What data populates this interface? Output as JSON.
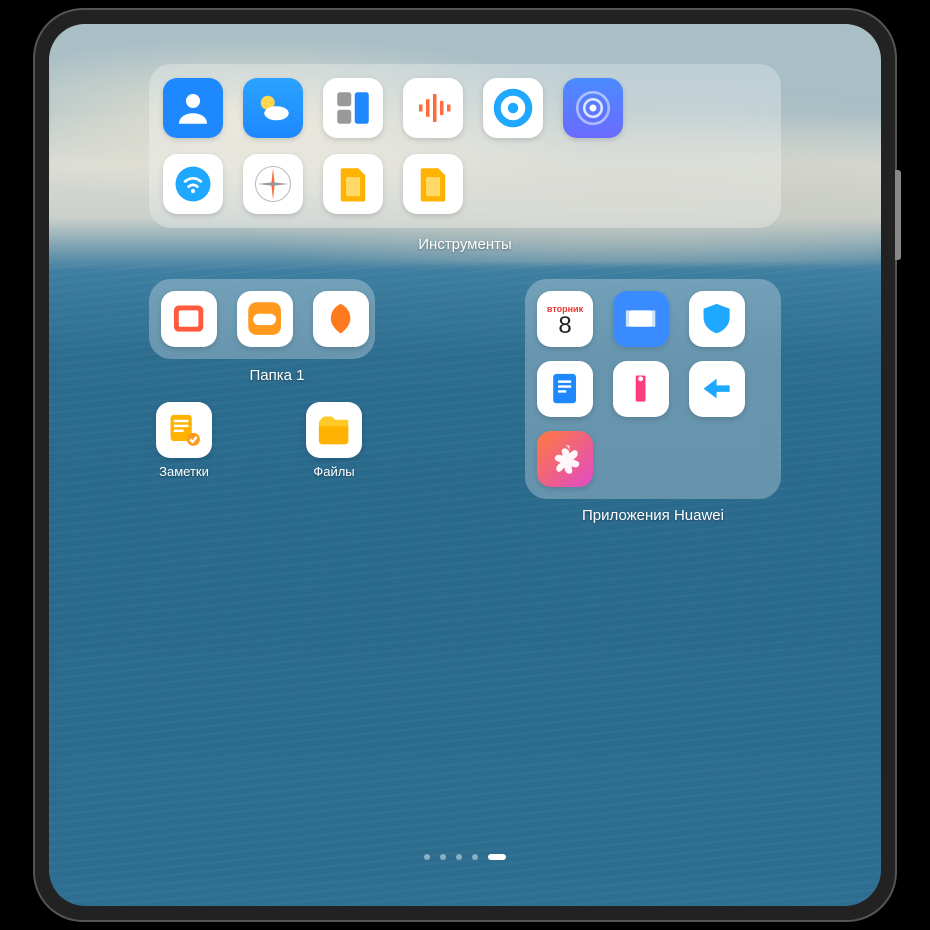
{
  "folders": {
    "tools": {
      "label": "Инструменты",
      "icons": [
        {
          "name": "contacts",
          "semantic": "contacts-icon"
        },
        {
          "name": "weather",
          "semantic": "weather-icon"
        },
        {
          "name": "calculator",
          "semantic": "calculator-icon"
        },
        {
          "name": "recorder",
          "semantic": "recorder-icon"
        },
        {
          "name": "disc",
          "semantic": "disc-icon"
        },
        {
          "name": "find-device",
          "semantic": "find-device-icon"
        },
        {
          "name": "wifi-share",
          "semantic": "wifi-icon"
        },
        {
          "name": "compass",
          "semantic": "compass-icon"
        },
        {
          "name": "sim1",
          "semantic": "sim-icon"
        },
        {
          "name": "sim2",
          "semantic": "sim-icon"
        }
      ]
    },
    "folder1": {
      "label": "Папка 1",
      "icons": [
        {
          "name": "books",
          "semantic": "book-icon"
        },
        {
          "name": "games",
          "semantic": "game-controller-icon"
        },
        {
          "name": "petal",
          "semantic": "petal-icon"
        }
      ]
    },
    "huawei": {
      "label": "Приложения Huawei",
      "calendar": {
        "weekday": "вторник",
        "day": "8"
      },
      "icons": [
        {
          "name": "calendar",
          "semantic": "calendar-icon"
        },
        {
          "name": "video",
          "semantic": "video-icon"
        },
        {
          "name": "optimizer",
          "semantic": "shield-icon"
        },
        {
          "name": "docs",
          "semantic": "document-icon"
        },
        {
          "name": "tips",
          "semantic": "info-icon"
        },
        {
          "name": "phone-clone",
          "semantic": "transfer-icon"
        },
        {
          "name": "game-center",
          "semantic": "flower-icon"
        }
      ]
    }
  },
  "apps": {
    "notes": {
      "label": "Заметки"
    },
    "files": {
      "label": "Файлы"
    }
  },
  "page_indicator": {
    "count": 5,
    "active_index": 4
  }
}
